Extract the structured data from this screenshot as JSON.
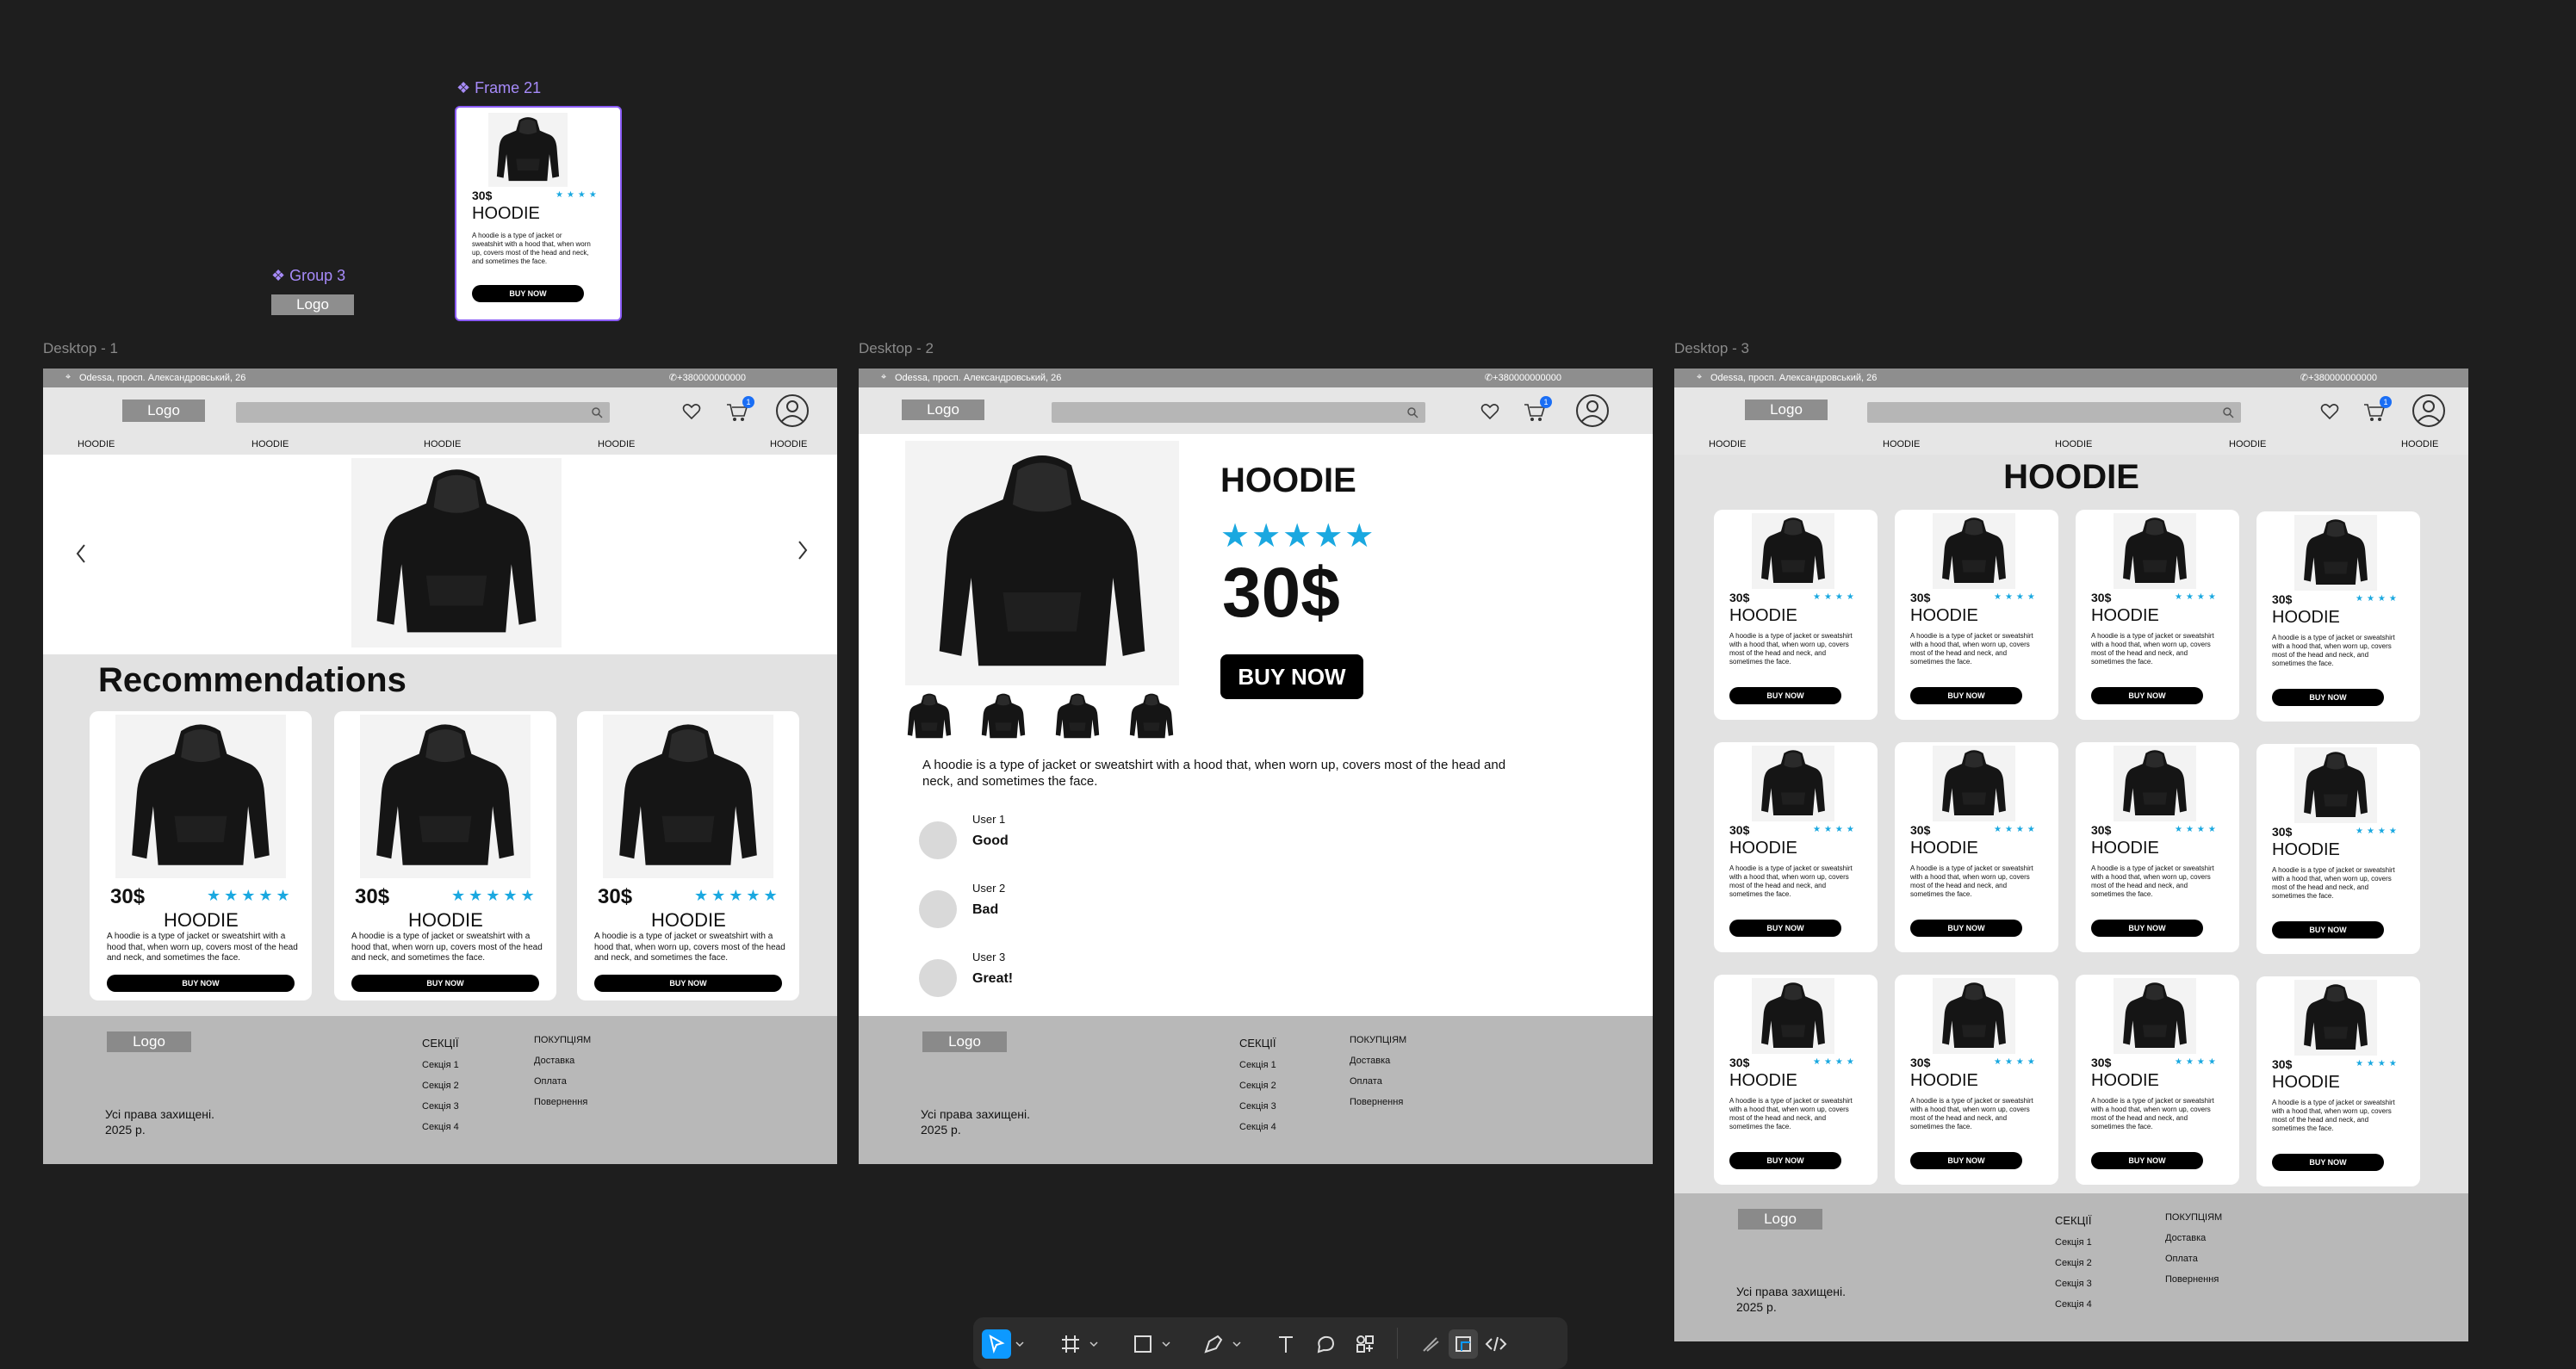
{
  "canvas": {
    "frame21_label": "Frame 21",
    "group3_label": "Group 3",
    "group3_logo": "Logo",
    "desktop1_label": "Desktop - 1",
    "desktop2_label": "Desktop - 2",
    "desktop3_label": "Desktop - 3"
  },
  "frame21_card": {
    "price": "30$",
    "stars": "★★★★",
    "title": "HOODIE",
    "desc": "A hoodie is a type of jacket or sweatshirt with a hood that, when worn up, covers most of the head and neck, and sometimes the face.",
    "buy": "BUY NOW"
  },
  "site": {
    "address": "Odessa, просп. Александровський, 26",
    "phone": "+380000000000",
    "logo": "Logo",
    "cart_count": "1",
    "nav": [
      "HOODIE",
      "HOODIE",
      "HOODIE",
      "HOODIE",
      "HOODIE"
    ],
    "footer": {
      "logo": "Logo",
      "rights_line1": "Усі права захищені.",
      "rights_line2": "2025 р.",
      "sections_title": "СЕКЦІЇ",
      "sections": [
        "Секція 1",
        "Секція 2",
        "Секція 3",
        "Секція 4"
      ],
      "purchases_title": "ПОКУПЦІЯМ",
      "purchases": [
        "Доставка",
        "Оплата",
        "Повернення"
      ]
    }
  },
  "desktop1": {
    "recommendations_title": "Recommendations",
    "card": {
      "price": "30$",
      "stars": "★★★★★",
      "title": "HOODIE",
      "desc": "A hoodie is a type of jacket or sweatshirt with a hood that, when worn up, covers most of the head and neck, and sometimes the face.",
      "buy": "BUY NOW"
    }
  },
  "desktop2": {
    "title": "HOODIE",
    "stars": "★★★★★",
    "price": "30$",
    "buy": "BUY NOW",
    "desc": "A hoodie is a type of jacket or sweatshirt with a hood that, when worn up, covers most of the head and neck, and sometimes the face.",
    "reviews": [
      {
        "user": "User 1",
        "text": "Good"
      },
      {
        "user": "User 2",
        "text": "Bad"
      },
      {
        "user": "User 3",
        "text": "Great!"
      }
    ]
  },
  "desktop3": {
    "heading": "HOODIE",
    "card": {
      "price": "30$",
      "stars": "★★★★",
      "title": "HOODIE",
      "desc": "A hoodie is a type of jacket or sweatshirt with a hood that, when worn up, covers most of the head and neck, and sometimes the face.",
      "buy": "BUY NOW"
    }
  },
  "toolbar": {
    "tools": [
      "move-tool",
      "frame-tool",
      "shape-tool",
      "pen-tool",
      "text-tool",
      "comment-tool",
      "actions-tool",
      "draw-mode",
      "design-mode",
      "dev-mode"
    ]
  },
  "colors": {
    "canvas_bg": "#1e1e1e",
    "star": "#1aa8e0",
    "selection": "#8b5cf6",
    "header_gray": "#8e8e8e",
    "footer_gray": "#b8b8b8"
  }
}
